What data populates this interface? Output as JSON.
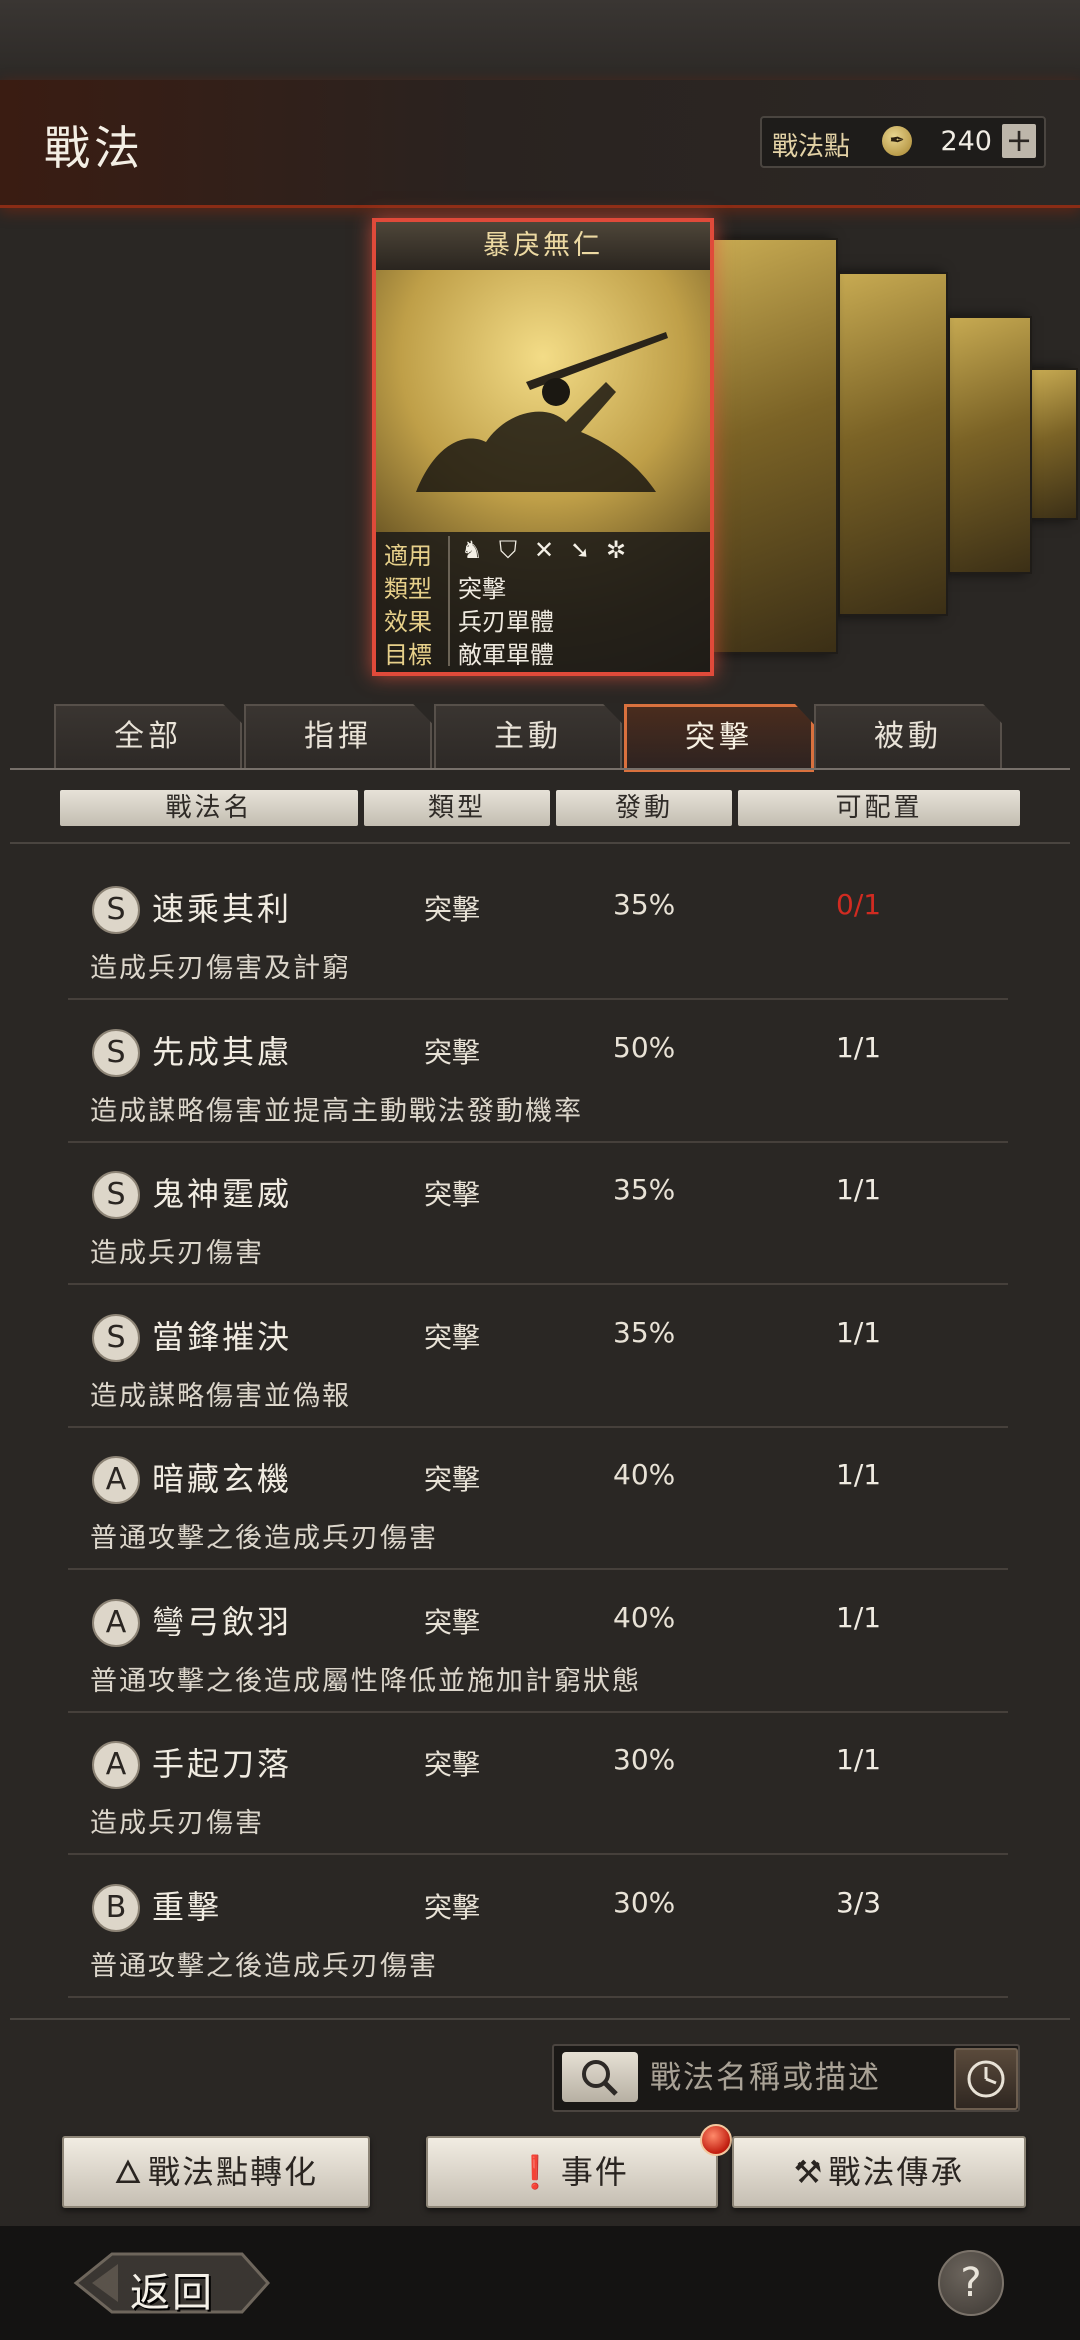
{
  "header": {
    "title": "戰法",
    "points_label": "戰法點",
    "points_value": "240",
    "plus_label": "+"
  },
  "card": {
    "name": "暴戾無仁",
    "info": [
      {
        "label": "適用",
        "value": ""
      },
      {
        "label": "類型",
        "value": "突擊"
      },
      {
        "label": "效果",
        "value": "兵刃單體"
      },
      {
        "label": "目標",
        "value": "敵軍單體"
      }
    ],
    "applicable_icons": [
      "cavalry-icon",
      "shield-icon",
      "archer-icon",
      "spear-icon",
      "siege-icon"
    ]
  },
  "tabs": [
    "全部",
    "指揮",
    "主動",
    "突擊",
    "被動"
  ],
  "active_tab": "突擊",
  "columns": [
    "戰法名",
    "類型",
    "發動",
    "可配置"
  ],
  "tactics": [
    {
      "grade": "S",
      "name": "速乘其利",
      "type": "突擊",
      "rate": "35%",
      "slots": "0/1",
      "desc": "造成兵刃傷害及計窮"
    },
    {
      "grade": "S",
      "name": "先成其慮",
      "type": "突擊",
      "rate": "50%",
      "slots": "1/1",
      "desc": "造成謀略傷害並提高主動戰法發動機率"
    },
    {
      "grade": "S",
      "name": "鬼神霆威",
      "type": "突擊",
      "rate": "35%",
      "slots": "1/1",
      "desc": "造成兵刃傷害"
    },
    {
      "grade": "S",
      "name": "當鋒摧決",
      "type": "突擊",
      "rate": "35%",
      "slots": "1/1",
      "desc": "造成謀略傷害並偽報"
    },
    {
      "grade": "A",
      "name": "暗藏玄機",
      "type": "突擊",
      "rate": "40%",
      "slots": "1/1",
      "desc": "普通攻擊之後造成兵刃傷害"
    },
    {
      "grade": "A",
      "name": "彎弓飲羽",
      "type": "突擊",
      "rate": "40%",
      "slots": "1/1",
      "desc": "普通攻擊之後造成屬性降低並施加計窮狀態"
    },
    {
      "grade": "A",
      "name": "手起刀落",
      "type": "突擊",
      "rate": "30%",
      "slots": "1/1",
      "desc": "造成兵刃傷害"
    },
    {
      "grade": "B",
      "name": "重擊",
      "type": "突擊",
      "rate": "30%",
      "slots": "3/3",
      "desc": "普通攻擊之後造成兵刃傷害"
    }
  ],
  "search": {
    "placeholder": "戰法名稱或描述"
  },
  "buttons": {
    "convert": "戰法點轉化",
    "events": "事件",
    "inherit": "戰法傳承"
  },
  "footer": {
    "back": "返回",
    "help": "?"
  },
  "colors": {
    "accent": "#d9713e",
    "warning": "#d12b21",
    "card_border": "#e04a3a"
  }
}
